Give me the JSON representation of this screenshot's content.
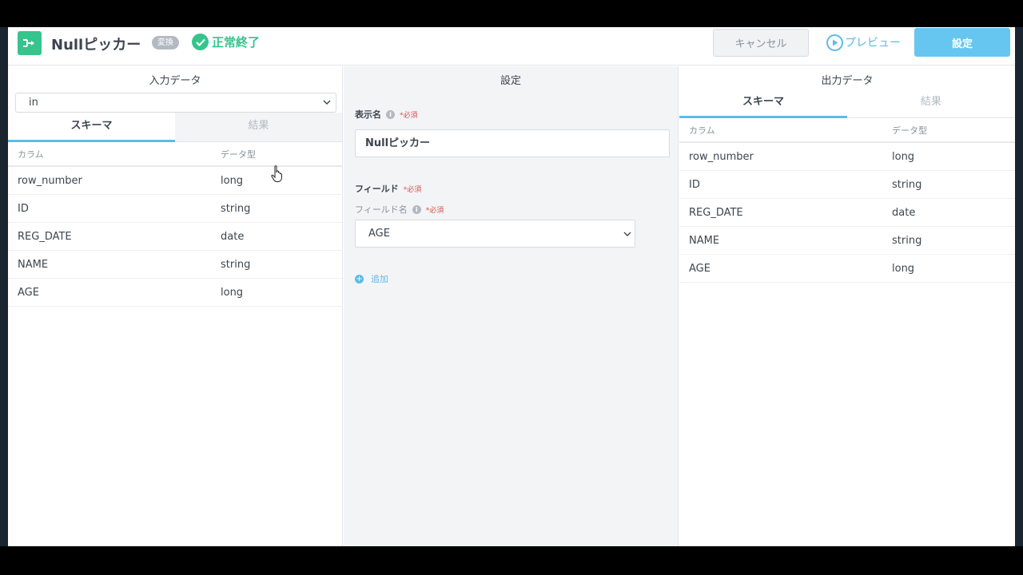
{
  "header": {
    "title": "Nullピッカー",
    "badge": "変換",
    "status": "正常終了",
    "cancel_label": "キャンセル",
    "preview_label": "プレビュー",
    "set_label": "設定"
  },
  "input_panel": {
    "title": "入力データ",
    "selected_input": "in",
    "tabs": [
      {
        "label": "スキーマ",
        "active": true
      },
      {
        "label": "結果",
        "active": false
      }
    ],
    "columns": [
      "カラム",
      "データ型"
    ],
    "rows": [
      {
        "name": "row_number",
        "type": "long"
      },
      {
        "name": "ID",
        "type": "string"
      },
      {
        "name": "REG_DATE",
        "type": "date"
      },
      {
        "name": "NAME",
        "type": "string"
      },
      {
        "name": "AGE",
        "type": "long"
      }
    ]
  },
  "settings_panel": {
    "title": "設定",
    "display_name_label": "表示名",
    "required": "*必須",
    "display_name_value": "Nullピッカー",
    "field_label": "フィールド",
    "field_name_label": "フィールド名",
    "field_value": "AGE",
    "add_label": "追加"
  },
  "output_panel": {
    "title": "出力データ",
    "tabs": [
      {
        "label": "スキーマ",
        "active": true
      },
      {
        "label": "結果",
        "active": false
      }
    ],
    "columns": [
      "カラム",
      "データ型"
    ],
    "rows": [
      {
        "name": "row_number",
        "type": "long"
      },
      {
        "name": "ID",
        "type": "string"
      },
      {
        "name": "REG_DATE",
        "type": "date"
      },
      {
        "name": "NAME",
        "type": "string"
      },
      {
        "name": "AGE",
        "type": "long"
      }
    ]
  },
  "colors": {
    "accent": "#5cbbe9",
    "success": "#35c48c",
    "required": "#d9534f"
  }
}
